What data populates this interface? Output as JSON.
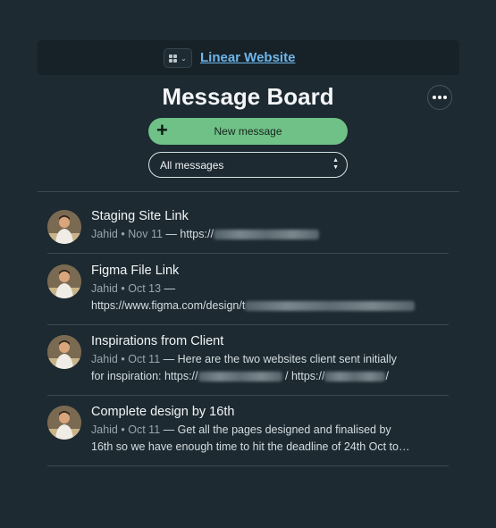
{
  "header": {
    "project_link": "Linear Website",
    "page_title": "Message Board",
    "new_message_label": "New message",
    "filter_value": "All messages"
  },
  "messages": [
    {
      "title": "Staging Site Link",
      "author": "Jahid",
      "date": "Nov 11",
      "line1": "— https://",
      "line2": ""
    },
    {
      "title": "Figma File Link",
      "author": "Jahid",
      "date": "Oct 13",
      "line1": "—",
      "line2": "https://www.figma.com/design/t"
    },
    {
      "title": "Inspirations from Client",
      "author": "Jahid",
      "date": "Oct 11",
      "line1": "— Here are the two websites client sent initially",
      "line2a": "for inspiration: https://",
      "line2b": "/ https://",
      "line2c": "/"
    },
    {
      "title": "Complete design by 16th",
      "author": "Jahid",
      "date": "Oct 11",
      "line1": "— Get all the pages designed and finalised by",
      "line2": "16th so we have enough time to hit the deadline of 24th Oct to…"
    }
  ],
  "colors": {
    "background": "#1d2a31",
    "accent_green": "#6fc187",
    "link_blue": "#6fb6ec"
  },
  "icons": {
    "switcher": "grid-icon",
    "more": "ellipsis-icon",
    "new": "plus-icon",
    "filter": "updown-arrows-icon"
  }
}
